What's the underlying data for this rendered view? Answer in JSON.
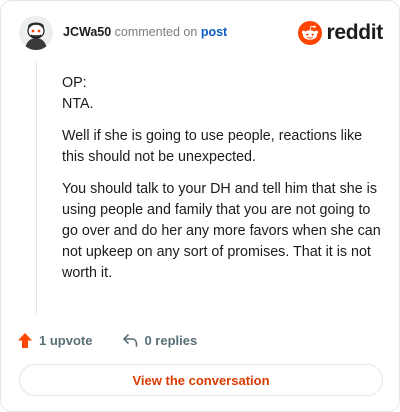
{
  "header": {
    "username": "JCWa50",
    "action": "commented on",
    "target": "post",
    "brand": "reddit"
  },
  "comment": {
    "paragraphs": [
      [
        "OP:",
        "NTA."
      ],
      [
        "Well if she is going to use people, reactions like",
        "this should not be unexpected."
      ],
      [
        "You should talk to your DH and tell him that she is",
        "using people and family that you are not going to",
        "go over and do her any more favors when she can",
        "not upkeep on any sort of promises. That it is not",
        "worth it."
      ]
    ]
  },
  "footer": {
    "upvotes": "1 upvote",
    "replies": "0 replies"
  },
  "cta": {
    "label": "View the conversation"
  },
  "colors": {
    "accent": "#ff4500",
    "link": "#0a5ec2",
    "cta_text": "#d93a00",
    "muted": "#576f76",
    "border": "#e4e6e8"
  },
  "icons": {
    "avatar": "snoo-avatar-icon",
    "brand": "reddit-logo-icon",
    "upvote": "upvote-arrow-icon",
    "reply": "reply-arrow-icon"
  }
}
